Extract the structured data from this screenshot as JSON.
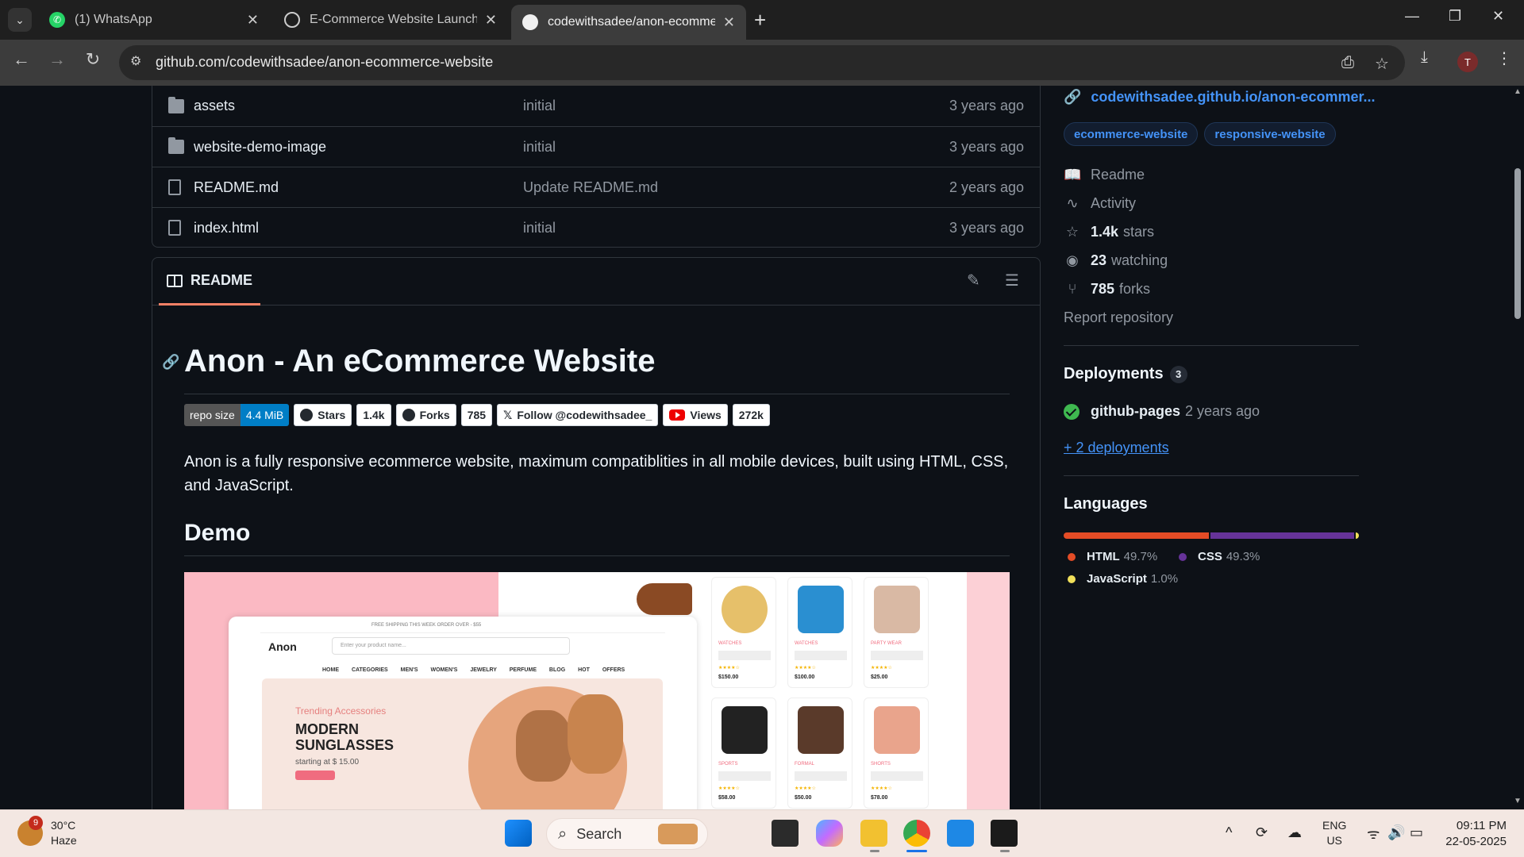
{
  "browser": {
    "tabs": [
      {
        "title": "(1) WhatsApp",
        "active": false
      },
      {
        "title": "E-Commerce Website Launch Pl",
        "active": false
      },
      {
        "title": "codewithsadee/anon-ecommerce-website",
        "active": true
      }
    ],
    "url": "github.com/codewithsadee/anon-ecommerce-website",
    "profile_initial": "T"
  },
  "files": [
    {
      "type": "folder",
      "name": "assets",
      "commit": "initial",
      "date": "3 years ago"
    },
    {
      "type": "folder",
      "name": "website-demo-image",
      "commit": "initial",
      "date": "3 years ago"
    },
    {
      "type": "file",
      "name": "README.md",
      "commit": "Update README.md",
      "date": "2 years ago"
    },
    {
      "type": "file",
      "name": "index.html",
      "commit": "initial",
      "date": "3 years ago"
    }
  ],
  "readme": {
    "tab_label": "README",
    "title": "Anon - An eCommerce Website",
    "badges": {
      "repo_size_label": "repo size",
      "repo_size_value": "4.4 MiB",
      "stars_label": "Stars",
      "stars_value": "1.4k",
      "forks_label": "Forks",
      "forks_value": "785",
      "follow_label": "Follow @codewithsadee_",
      "views_label": "Views",
      "views_value": "272k"
    },
    "description": "Anon is a fully responsive ecommerce website, maximum compatiblities in all mobile devices, built using HTML, CSS, and JavaScript.",
    "demo_heading": "Demo",
    "demo": {
      "logo": "Anon",
      "search_placeholder": "Enter your product name...",
      "menu": "HOME CATEGORIES MEN'S WOMEN'S JEWELRY PERFUME BLOG HOT OFFERS",
      "top_note": "FREE SHIPPING THIS WEEK ORDER OVER - $55",
      "banner_kicker": "Trending Accessories",
      "banner_title_1": "MODERN",
      "banner_title_2": "SUNGLASSES",
      "banner_price": "starting at $ 15.00",
      "products": [
        {
          "cat": "WATCHES",
          "price": "$150.00"
        },
        {
          "cat": "WATCHES",
          "price": "$100.00"
        },
        {
          "cat": "PARTY WEAR",
          "price": "$25.00"
        },
        {
          "cat": "SPORTS",
          "price": "$58.00"
        },
        {
          "cat": "FORMAL",
          "price": "$50.00"
        },
        {
          "cat": "SHORTS",
          "price": "$78.00"
        }
      ]
    }
  },
  "sidebar": {
    "homepage": "codewithsadee.github.io/anon-ecommer...",
    "topics": [
      "ecommerce-website",
      "responsive-website"
    ],
    "readme": "Readme",
    "activity": "Activity",
    "stars_count": "1.4k",
    "stars_label": "stars",
    "watching_count": "23",
    "watching_label": "watching",
    "forks_count": "785",
    "forks_label": "forks",
    "report": "Report repository",
    "deployments_heading": "Deployments",
    "deployments_count": "3",
    "deployment_name": "github-pages",
    "deployment_time": "2 years ago",
    "more_deployments": "+ 2 deployments",
    "languages_heading": "Languages",
    "languages": [
      {
        "name": "HTML",
        "percent": "49.7%",
        "value": 49.7,
        "color": "#e34c26"
      },
      {
        "name": "CSS",
        "percent": "49.3%",
        "value": 49.3,
        "color": "#663399"
      },
      {
        "name": "JavaScript",
        "percent": "1.0%",
        "value": 1.0,
        "color": "#f1e05a"
      }
    ]
  },
  "taskbar": {
    "temperature": "30°C",
    "weather": "Haze",
    "weather_badge": "9",
    "search_label": "Search",
    "lang_1": "ENG",
    "lang_2": "US",
    "time": "09:11 PM",
    "date": "22-05-2025"
  },
  "colors": {
    "accent": "#4493f8",
    "readme_underline": "#f78166",
    "success": "#3fb950"
  }
}
